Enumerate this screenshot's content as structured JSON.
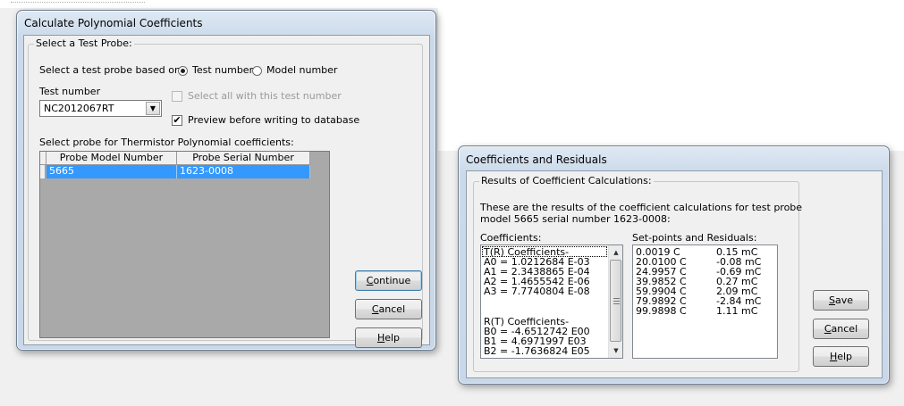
{
  "dialog1": {
    "title": "Calculate Polynomial Coefficients",
    "group_title": "Select a Test Probe:",
    "select_based_on_label": "Select a test probe based on:",
    "radio_test_number": "Test number",
    "radio_model_number": "Model number",
    "test_number_label": "Test number",
    "test_number_value": "NC2012067RT",
    "select_all_label": "Select all with this test number",
    "preview_label": "Preview before writing to database",
    "select_probe_label": "Select probe for Thermistor Polynomial coefficients:",
    "table": {
      "columns": [
        "Probe Model Number",
        "Probe Serial Number"
      ],
      "rows": [
        [
          "5665",
          "1623-0008"
        ]
      ]
    },
    "buttons": {
      "continue": "Continue",
      "cancel": "Cancel",
      "help": "Help"
    }
  },
  "dialog2": {
    "title": "Coefficients and Residuals",
    "group_title": "Results of Coefficient Calculations:",
    "description_line1": "These are the results of the coefficient calculations for test probe",
    "description_line2": "model 5665 serial number 1623-0008:",
    "coefficients_label": "Coefficients:",
    "residuals_label": "Set-points and Residuals:",
    "coefficients": [
      "T(R) Coefficients-",
      "A0 = 1.0212684 E-03",
      "A1 = 2.3438865 E-04",
      "A2 = 1.4655542 E-06",
      "A3 = 7.7740804 E-08",
      "",
      "R(T) Coefficients-",
      "B0 = -4.6512742 E00",
      "B1 = 4.6971997 E03",
      "B2 = -1.7636824 E05"
    ],
    "setpoints": [
      {
        "temp": "0.0019 C",
        "residual": "0.15 mC"
      },
      {
        "temp": "20.0100 C",
        "residual": "-0.08 mC"
      },
      {
        "temp": "24.9957 C",
        "residual": "-0.69 mC"
      },
      {
        "temp": "39.9852 C",
        "residual": "0.27 mC"
      },
      {
        "temp": "59.9904 C",
        "residual": "2.09 mC"
      },
      {
        "temp": "79.9892 C",
        "residual": "-2.84 mC"
      },
      {
        "temp": "99.9898 C",
        "residual": "1.11 mC"
      }
    ],
    "buttons": {
      "save": "Save",
      "cancel": "Cancel",
      "help": "Help"
    }
  }
}
